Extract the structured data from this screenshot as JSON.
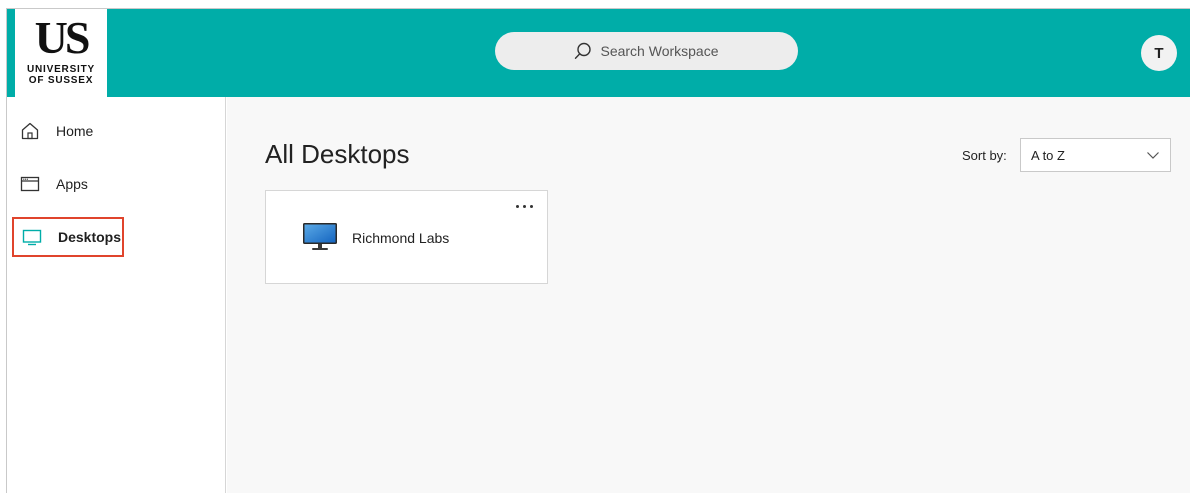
{
  "brand": {
    "logo_mark": "US",
    "logo_line1": "UNIVERSITY",
    "logo_line2": "OF SUSSEX",
    "header_color": "#00ada8"
  },
  "search": {
    "placeholder": "Search Workspace",
    "icon": "search-icon"
  },
  "user": {
    "avatar_initial": "T"
  },
  "sidebar": {
    "items": [
      {
        "label": "Home",
        "icon": "home-icon",
        "active": false
      },
      {
        "label": "Apps",
        "icon": "apps-window-icon",
        "active": false
      },
      {
        "label": "Desktops",
        "icon": "desktop-icon",
        "active": true,
        "icon_color": "#00ada8",
        "highlight_color": "#e0442c"
      }
    ]
  },
  "main": {
    "title": "All Desktops",
    "sort": {
      "label": "Sort by:",
      "value": "A to Z"
    },
    "desktops": [
      {
        "name": "Richmond Labs",
        "icon": "monitor-icon",
        "more_icon": "more-options-icon"
      }
    ]
  }
}
